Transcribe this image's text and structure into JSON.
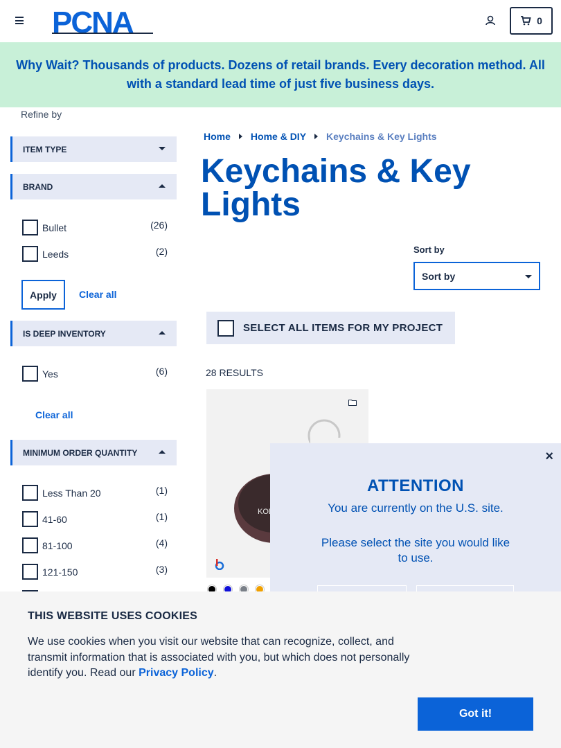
{
  "header": {
    "logo_text": "PCNA",
    "cart_count": "0"
  },
  "banner": {
    "text": "Why Wait? Thousands of products. Dozens of retail brands. Every decoration method. All with a standard lead time of just five business days."
  },
  "sidebar": {
    "refine_label": "Refine by",
    "facets": [
      {
        "title": "ITEM TYPE",
        "expanded": false
      },
      {
        "title": "BRAND",
        "expanded": true,
        "options": [
          {
            "label": "Bullet",
            "count": "(26)"
          },
          {
            "label": "Leeds",
            "count": "(2)"
          }
        ],
        "apply_label": "Apply",
        "clear_label": "Clear all"
      },
      {
        "title": "IS DEEP INVENTORY",
        "expanded": true,
        "options": [
          {
            "label": "Yes",
            "count": "(6)"
          }
        ],
        "clear_label": "Clear all"
      },
      {
        "title": "MINIMUM ORDER QUANTITY",
        "expanded": true,
        "options": [
          {
            "label": "Less Than 20",
            "count": "(1)"
          },
          {
            "label": "41-60",
            "count": "(1)"
          },
          {
            "label": "81-100",
            "count": "(4)"
          },
          {
            "label": "121-150",
            "count": "(3)"
          }
        ]
      }
    ]
  },
  "breadcrumb": [
    "Home",
    "Home & DIY",
    "Keychains & Key Lights"
  ],
  "main": {
    "title": "Keychains & Key Lights",
    "sort_label": "Sort by",
    "sort_value": "Sort by",
    "select_all_label": "SELECT ALL ITEMS FOR MY PROJECT",
    "results_label": "28 RESULTS",
    "swatch_colors": [
      "#000000",
      "#1010d8",
      "#7a8088",
      "#f0a000"
    ]
  },
  "modal": {
    "close": "×",
    "title": "ATTENTION",
    "line1": "You are currently on the U.S. site.",
    "line2": "Please select the site you would like to use."
  },
  "cookie": {
    "title": "THIS WEBSITE USES COOKIES",
    "body": "We use cookies when you visit our website that can recognize, collect, and transmit information that is associated with you, but which does not personally identify you. Read our",
    "link": "Privacy Policy",
    "period": ".",
    "button": "Got it!"
  }
}
